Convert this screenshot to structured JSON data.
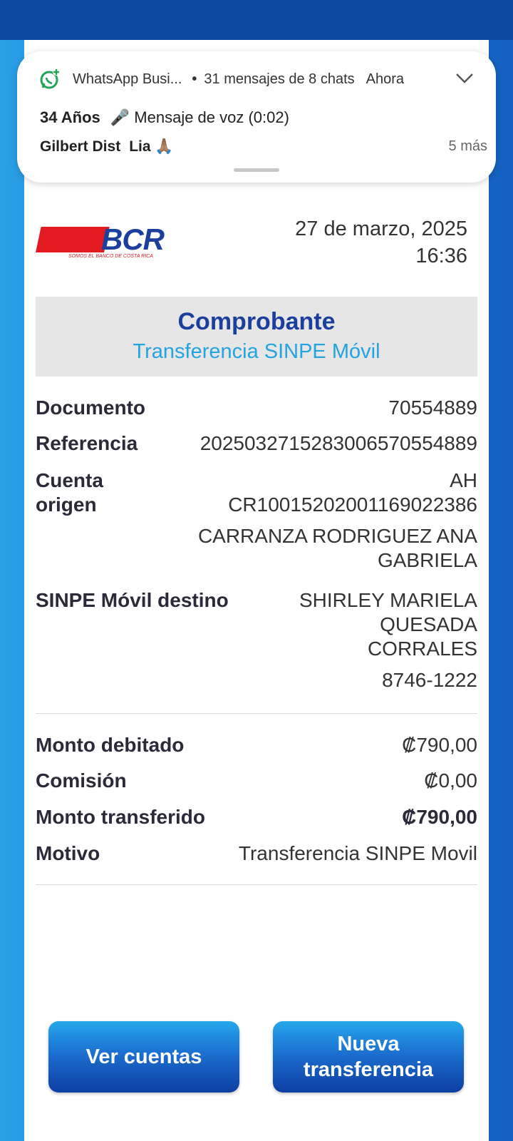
{
  "notification": {
    "app_name": "WhatsApp Busi...",
    "summary": "31 mensajes de 8 chats",
    "time": "Ahora",
    "line1_sender": "34 Años",
    "line1_message": "🎤 Mensaje de voz (0:02)",
    "line2_sender": "Gilbert Dist",
    "line2_message": "Lia 🙏🏽",
    "more": "5 más"
  },
  "receipt": {
    "logo_text": "BCR",
    "logo_tagline": "SOMOS EL BANCO DE COSTA RICA",
    "date": "27 de marzo, 2025",
    "time": "16:36",
    "title": "Comprobante",
    "subtitle": "Transferencia SINPE Móvil",
    "fields": {
      "documento_label": "Documento",
      "documento_value": "70554889",
      "referencia_label": "Referencia",
      "referencia_value": "2025032715283006570554889",
      "cuenta_label_1": "Cuenta",
      "cuenta_label_2": "origen",
      "cuenta_value_1": "AH",
      "cuenta_value_2": "CR10015202001169022386",
      "cuenta_value_3": "CARRANZA RODRIGUEZ ANA",
      "cuenta_value_4": "GABRIELA",
      "destino_label": "SINPE Móvil destino",
      "destino_value_1": "SHIRLEY MARIELA",
      "destino_value_2": "QUESADA",
      "destino_value_3": "CORRALES",
      "destino_value_4": "8746-1222",
      "monto_debitado_label": "Monto debitado",
      "monto_debitado_value": "₡790,00",
      "comision_label": "Comisión",
      "comision_value": "₡0,00",
      "monto_transferido_label": "Monto transferido",
      "monto_transferido_value": "₡790,00",
      "motivo_label": "Motivo",
      "motivo_value": "Transferencia SINPE Movil"
    }
  },
  "buttons": {
    "ver_cuentas": "Ver cuentas",
    "nueva_1": "Nueva",
    "nueva_2": "transferencia"
  }
}
